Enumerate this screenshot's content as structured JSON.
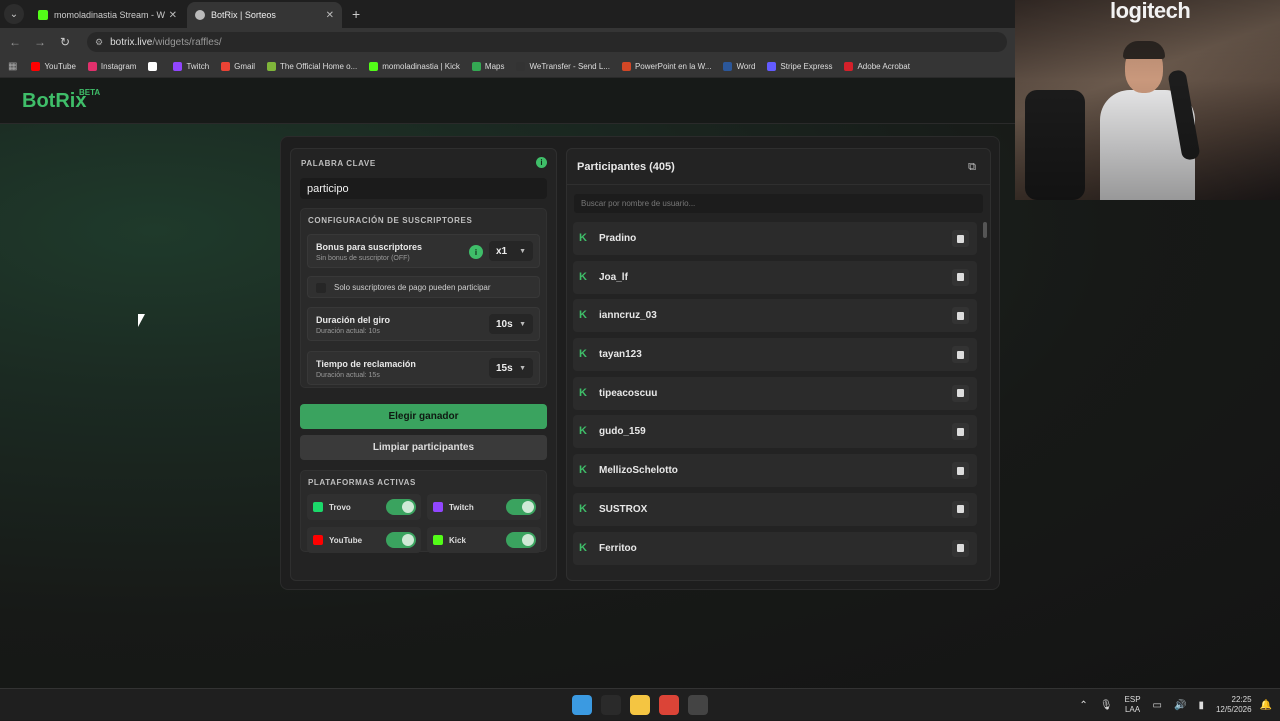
{
  "browser": {
    "tabs": [
      {
        "title": "momoladinastia Stream - Watch",
        "color": "#53fc18"
      },
      {
        "title": "BotRix | Sorteos",
        "color": "#bbbbbb"
      }
    ],
    "url_host": "botrix.live",
    "url_path": "/widgets/raffles/",
    "bookmarks": [
      {
        "label": "YouTube",
        "color": "#ff0000"
      },
      {
        "label": "Instagram",
        "color": "#e1306c"
      },
      {
        "label": "",
        "color": "#ffffff"
      },
      {
        "label": "Twitch",
        "color": "#9146ff"
      },
      {
        "label": "Gmail",
        "color": "#ea4335"
      },
      {
        "label": "The Official Home o...",
        "color": "#7fb53a"
      },
      {
        "label": "momoladinastia | Kick",
        "color": "#53fc18"
      },
      {
        "label": "Maps",
        "color": "#34a853"
      },
      {
        "label": "WeTransfer - Send L...",
        "color": "#333333"
      },
      {
        "label": "PowerPoint en la W...",
        "color": "#d24726"
      },
      {
        "label": "Word",
        "color": "#2b579a"
      },
      {
        "label": "Stripe Express",
        "color": "#635bff"
      },
      {
        "label": "Adobe Acrobat",
        "color": "#d4202a"
      }
    ]
  },
  "app": {
    "logo": "BotRix",
    "logo_badge": "BETA"
  },
  "raffle": {
    "keyword_label": "PALABRA CLAVE",
    "keyword_value": "participo",
    "sub_config_label": "CONFIGURACIÓN DE SUSCRIPTORES",
    "bonus_title": "Bonus para suscriptores",
    "bonus_desc": "Sin bonus de suscriptor (OFF)",
    "bonus_value": "x1",
    "paid_only_label": "Solo suscriptores de pago pueden participar",
    "spin_title": "Duración del giro",
    "spin_desc": "Duración actual: 10s",
    "spin_value": "10s",
    "claim_title": "Tiempo de reclamación",
    "claim_desc": "Duración actual: 15s",
    "claim_value": "15s",
    "pick_winner": "Elegir ganador",
    "clear_participants": "Limpiar participantes",
    "platforms_label": "PLATAFORMAS ACTIVAS",
    "platforms": [
      {
        "name": "Trovo",
        "color": "#1bd96a",
        "on": true
      },
      {
        "name": "Twitch",
        "color": "#9146ff",
        "on": true
      },
      {
        "name": "YouTube",
        "color": "#ff0000",
        "on": true
      },
      {
        "name": "Kick",
        "color": "#53fc18",
        "on": true
      }
    ]
  },
  "participants": {
    "title": "Participantes (405)",
    "search_placeholder": "Buscar por nombre de usuario...",
    "list": [
      "Pradino",
      "Joa_lf",
      "ianncruz_03",
      "tayan123",
      "tipeacoscuu",
      "gudo_159",
      "MellizoSchelotto",
      "SUSTROX",
      "Ferritoo"
    ]
  },
  "webcam": {
    "brand": "logitech"
  },
  "taskbar": {
    "lang1": "ESP",
    "lang2": "LAA",
    "time": "22:25",
    "date": "12/5/2026",
    "apps": [
      {
        "name": "start",
        "color": "#3b9ae1"
      },
      {
        "name": "search",
        "color": "#2a2a2a"
      },
      {
        "name": "file-explorer",
        "color": "#f4c542"
      },
      {
        "name": "chrome",
        "color": "#db4437"
      },
      {
        "name": "obs",
        "color": "#444444"
      }
    ]
  },
  "colors": {
    "accent": "#3fbe69"
  }
}
